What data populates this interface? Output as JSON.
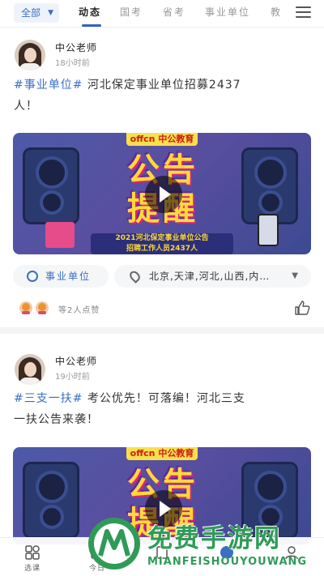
{
  "top_nav": {
    "filter_label": "全部",
    "tabs": [
      {
        "label": "动态",
        "active": true
      },
      {
        "label": "国考",
        "active": false
      },
      {
        "label": "省考",
        "active": false
      },
      {
        "label": "事业单位",
        "active": false
      },
      {
        "label": "教",
        "active": false
      }
    ],
    "menu_icon": "hamburger-icon"
  },
  "posts": [
    {
      "author": "中公老师",
      "time": "18小时前",
      "hashtag": "#事业单位#",
      "text_line1": " 河北保定事业单位招募2437",
      "text_line2": "人！",
      "cover": {
        "logo": "offcn 中公教育",
        "headline_line1": "公告",
        "headline_line2": "提醒",
        "banner_line1": "2021河北保定事业单位公告",
        "banner_line2": "招聘工作人员2437人"
      },
      "category_tag": "事业单位",
      "location_tag": "北京,天津,河北,山西,内…",
      "likes_text": "等2人点赞"
    },
    {
      "author": "中公老师",
      "time": "19小时前",
      "hashtag": "#三支一扶#",
      "text_line1": " 考公优先！可落编！河北三支",
      "text_line2": "一扶公告来袭！",
      "cover": {
        "logo": "offcn 中公教育",
        "headline_line1": "公告",
        "headline_line2": "提醒"
      }
    }
  ],
  "bottom_nav": {
    "items": [
      {
        "label": "选课",
        "icon": "grid-icon"
      },
      {
        "label": "今日",
        "icon": "calendar-icon"
      },
      {
        "label": "",
        "icon": "book-icon"
      },
      {
        "label": "",
        "icon": "chat-icon"
      },
      {
        "label": "",
        "icon": "user-icon"
      }
    ]
  },
  "watermark": {
    "title": "免费手游网",
    "subtitle": "MIANFEISHOUYOUWANG"
  },
  "colors": {
    "accent": "#3a6fc4",
    "watermark_green": "#2f9b57"
  }
}
